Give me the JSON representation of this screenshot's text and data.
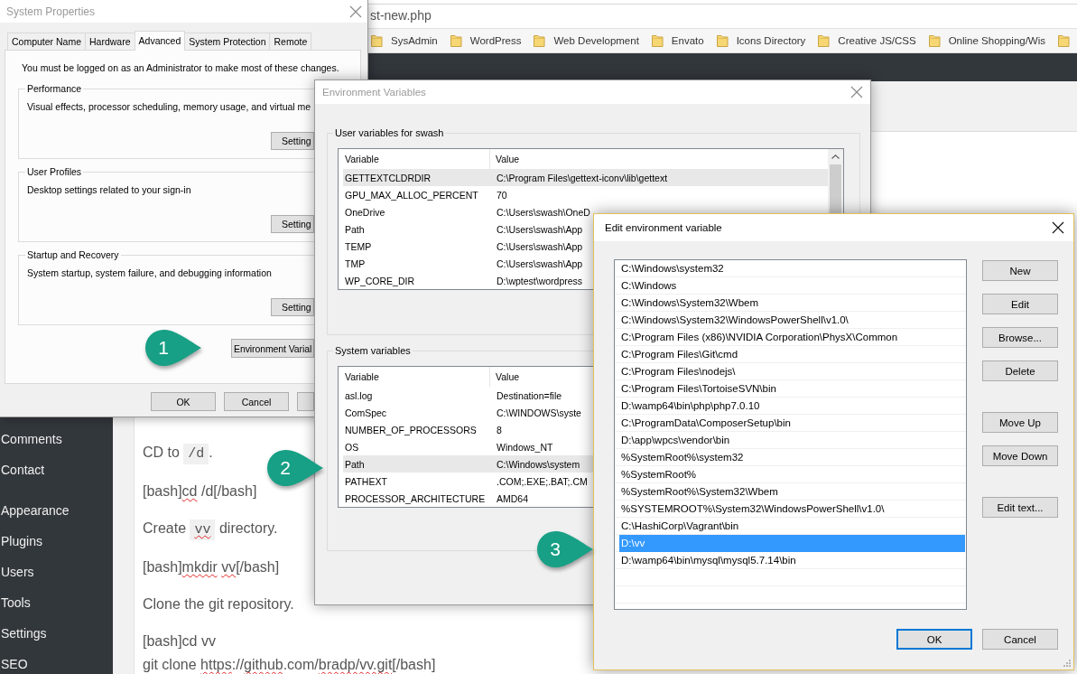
{
  "browser": {
    "address": "st-new.php",
    "bookmarks": [
      {
        "kind": "folder",
        "label": "SysAdmin"
      },
      {
        "kind": "folder",
        "label": "WordPress"
      },
      {
        "kind": "folder",
        "label": "Web Development"
      },
      {
        "kind": "folder",
        "label": "Envato"
      },
      {
        "kind": "folder",
        "label": "Icons Directory"
      },
      {
        "kind": "folder",
        "label": "Creative JS/CSS"
      },
      {
        "kind": "folder",
        "label": "Online Shopping/Wis"
      },
      {
        "kind": "folder"
      }
    ]
  },
  "sidebar": {
    "groups": [
      {
        "items": [
          {
            "label": "Comments"
          },
          {
            "label": "Contact"
          }
        ]
      },
      {
        "items": [
          {
            "label": "Appearance"
          },
          {
            "label": "Plugins"
          },
          {
            "label": "Users"
          },
          {
            "label": "Tools"
          },
          {
            "label": "Settings"
          },
          {
            "label": "SEO"
          }
        ]
      }
    ]
  },
  "editor": {
    "paragraphs": [
      {
        "lines": [
          [
            {
              "text": "CD to ",
              "kind": "text",
              "misspelled": false
            },
            {
              "text": "/d",
              "kind": "code",
              "misspelled": false
            },
            {
              "text": ".",
              "kind": "text",
              "misspelled": false
            }
          ]
        ]
      },
      {
        "lines": [
          [
            {
              "text": "[bash]",
              "kind": "text",
              "misspelled": false
            },
            {
              "text": "cd",
              "kind": "text",
              "misspelled": true
            },
            {
              "text": " /d[/bash]",
              "kind": "text",
              "misspelled": false
            }
          ]
        ]
      },
      {
        "lines": [
          [
            {
              "text": "Create ",
              "kind": "text",
              "misspelled": false
            },
            {
              "text": "vv",
              "kind": "code",
              "misspelled": true
            },
            {
              "text": " directory.",
              "kind": "text",
              "misspelled": false
            }
          ]
        ]
      },
      {
        "lines": [
          [
            {
              "text": "[bash]",
              "kind": "text",
              "misspelled": false
            },
            {
              "text": "mkdir vv",
              "kind": "text",
              "misspelled": true
            },
            {
              "text": "[/bash]",
              "kind": "text",
              "misspelled": false
            }
          ]
        ]
      },
      {
        "lines": [
          [
            {
              "text": "Clone the git repository.",
              "kind": "text",
              "misspelled": false
            }
          ]
        ]
      },
      {
        "lines": [
          [
            {
              "text": "[bash]cd vv",
              "kind": "text",
              "misspelled": false
            }
          ],
          [
            {
              "text": "git clone ",
              "kind": "text",
              "misspelled": false
            },
            {
              "text": "https",
              "kind": "text",
              "misspelled": true
            },
            {
              "text": "://",
              "kind": "text",
              "misspelled": false
            },
            {
              "text": "github",
              "kind": "text",
              "misspelled": true
            },
            {
              "text": ".com/",
              "kind": "text",
              "misspelled": false
            },
            {
              "text": "bradp/vv.git",
              "kind": "text",
              "misspelled": true
            },
            {
              "text": "[/bash]",
              "kind": "text",
              "misspelled": false
            }
          ]
        ]
      }
    ]
  },
  "system_properties": {
    "title": "System Properties",
    "active": false,
    "tabs": [
      {
        "label": "Computer Name",
        "selected": false
      },
      {
        "label": "Hardware",
        "selected": false
      },
      {
        "label": "Advanced",
        "selected": true
      },
      {
        "label": "System Protection",
        "selected": false
      },
      {
        "label": "Remote",
        "selected": false
      }
    ],
    "notice": "You must be logged on as an Administrator to make most of these changes.",
    "groups": [
      {
        "label": "Performance",
        "description": "Visual effects, processor scheduling, memory usage, and virtual me",
        "button": "Setting"
      },
      {
        "label": "User Profiles",
        "description": "Desktop settings related to your sign-in",
        "button": "Setting"
      },
      {
        "label": "Startup and Recovery",
        "description": "System startup, system failure, and debugging information",
        "button": "Setting"
      }
    ],
    "environment_button": "Environment Varial",
    "footer_buttons": [
      {
        "kind": "text",
        "label": "OK"
      },
      {
        "kind": "text",
        "label": "Cancel"
      },
      {
        "kind": "blank"
      }
    ]
  },
  "environment_variables": {
    "title": "Environment Variables",
    "active": false,
    "user_variables": {
      "label": "User variables for swash",
      "columns": [
        "Variable",
        "Value"
      ],
      "rows": [
        {
          "variable": "GETTEXTCLDRDIR",
          "value": "C:\\Program Files\\gettext-iconv\\lib\\gettext",
          "selected": true
        },
        {
          "variable": "GPU_MAX_ALLOC_PERCENT",
          "value": "70",
          "selected": false
        },
        {
          "variable": "OneDrive",
          "value": "C:\\Users\\swash\\OneD",
          "selected": false
        },
        {
          "variable": "Path",
          "value": "C:\\Users\\swash\\App",
          "selected": false
        },
        {
          "variable": "TEMP",
          "value": "C:\\Users\\swash\\App",
          "selected": false
        },
        {
          "variable": "TMP",
          "value": "C:\\Users\\swash\\App",
          "selected": false
        },
        {
          "variable": "WP_CORE_DIR",
          "value": "D:\\wptest\\wordpress",
          "selected": false
        }
      ]
    },
    "system_variables": {
      "label": "System variables",
      "columns": [
        "Variable",
        "Value"
      ],
      "rows": [
        {
          "variable": "asl.log",
          "value": "Destination=file",
          "selected": false
        },
        {
          "variable": "ComSpec",
          "value": "C:\\WINDOWS\\syste",
          "selected": false
        },
        {
          "variable": "NUMBER_OF_PROCESSORS",
          "value": "8",
          "selected": false
        },
        {
          "variable": "OS",
          "value": "Windows_NT",
          "selected": false
        },
        {
          "variable": "Path",
          "value": "C:\\Windows\\system",
          "selected": true
        },
        {
          "variable": "PATHEXT",
          "value": ".COM;.EXE;.BAT;.CM",
          "selected": false
        },
        {
          "variable": "PROCESSOR_ARCHITECTURE",
          "value": "AMD64",
          "selected": false
        }
      ]
    }
  },
  "edit_variable": {
    "title": "Edit environment variable",
    "active": true,
    "entries": [
      {
        "text": "C:\\Windows\\system32",
        "selected": false
      },
      {
        "text": "C:\\Windows",
        "selected": false
      },
      {
        "text": "C:\\Windows\\System32\\Wbem",
        "selected": false
      },
      {
        "text": "C:\\Windows\\System32\\WindowsPowerShell\\v1.0\\",
        "selected": false
      },
      {
        "text": "C:\\Program Files (x86)\\NVIDIA Corporation\\PhysX\\Common",
        "selected": false
      },
      {
        "text": "C:\\Program Files\\Git\\cmd",
        "selected": false
      },
      {
        "text": "C:\\Program Files\\nodejs\\",
        "selected": false
      },
      {
        "text": "C:\\Program Files\\TortoiseSVN\\bin",
        "selected": false
      },
      {
        "text": "D:\\wamp64\\bin\\php\\php7.0.10",
        "selected": false
      },
      {
        "text": "C:\\ProgramData\\ComposerSetup\\bin",
        "selected": false
      },
      {
        "text": "D:\\app\\wpcs\\vendor\\bin",
        "selected": false
      },
      {
        "text": "%SystemRoot%\\system32",
        "selected": false
      },
      {
        "text": "%SystemRoot%",
        "selected": false
      },
      {
        "text": "%SystemRoot%\\System32\\Wbem",
        "selected": false
      },
      {
        "text": "%SYSTEMROOT%\\System32\\WindowsPowerShell\\v1.0\\",
        "selected": false
      },
      {
        "text": "C:\\HashiCorp\\Vagrant\\bin",
        "selected": false
      },
      {
        "text": "D:\\vv",
        "selected": true
      },
      {
        "text": "D:\\wamp64\\bin\\mysql\\mysql5.7.14\\bin",
        "selected": false
      }
    ],
    "button_groups": [
      {
        "buttons": [
          "New",
          "Edit",
          "Browse...",
          "Delete"
        ]
      },
      {
        "buttons": [
          "Move Up",
          "Move Down"
        ]
      },
      {
        "buttons": [
          "Edit text..."
        ]
      }
    ],
    "footer_buttons": [
      {
        "label": "OK",
        "default": true
      },
      {
        "label": "Cancel",
        "default": false
      }
    ]
  },
  "callouts": [
    {
      "label": "1"
    },
    {
      "label": "2"
    },
    {
      "label": "3"
    }
  ]
}
